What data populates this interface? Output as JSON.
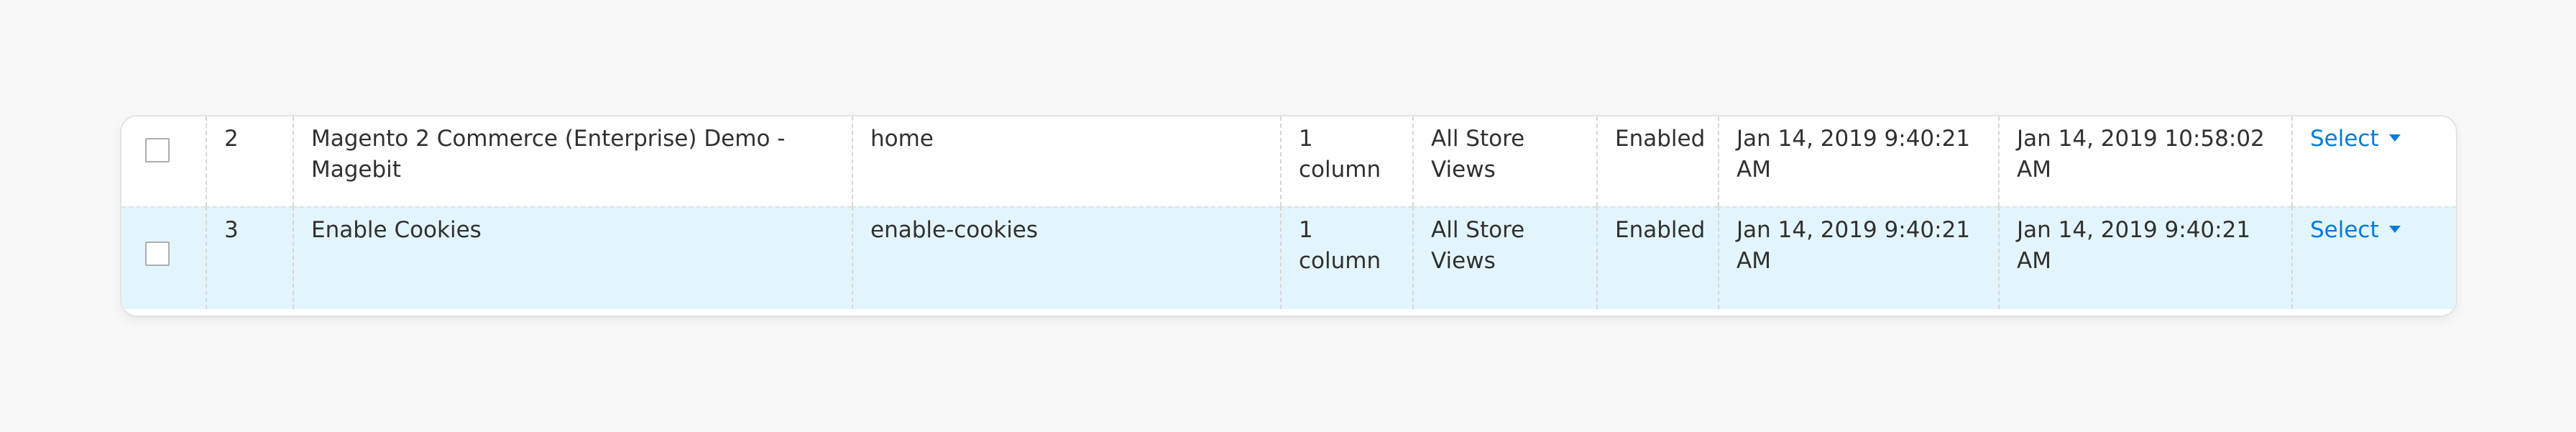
{
  "table": {
    "rows": [
      {
        "id": "2",
        "title": "Magento 2 Commerce (Enterprise) Demo - Magebit",
        "url_key": "home",
        "layout": "1 column",
        "store_view": "All Store Views",
        "status": "Enabled",
        "created": "Jan 14, 2019 9:40:21 AM",
        "modified": "Jan 14, 2019 10:58:02 AM",
        "action": "Select"
      },
      {
        "id": "3",
        "title": "Enable Cookies",
        "url_key": "enable-cookies",
        "layout": "1 column",
        "store_view": "All Store Views",
        "status": "Enabled",
        "created": "Jan 14, 2019 9:40:21 AM",
        "modified": "Jan 14, 2019 9:40:21 AM",
        "action": "Select"
      }
    ],
    "colors": {
      "row_highlight": "#e3f5fc",
      "link": "#007bdb"
    },
    "icons": {
      "action_caret": "caret-down-icon"
    }
  }
}
